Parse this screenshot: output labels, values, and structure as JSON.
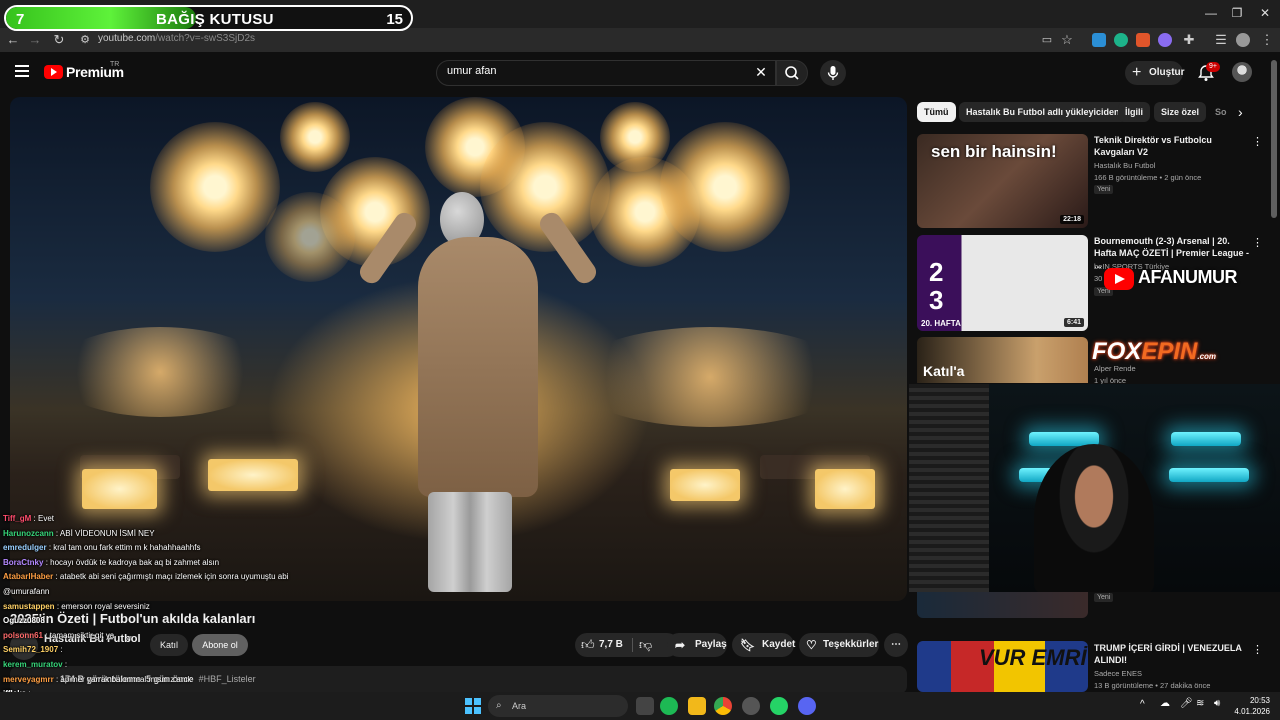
{
  "donation": {
    "count": "7",
    "title": "BAĞIŞ KUTUSU",
    "goal": "15",
    "progress": 0.47
  },
  "browser": {
    "url_host": "youtube.com",
    "url_path": "/watch?v=-swS3SjD2s"
  },
  "header": {
    "brand": "Premium",
    "region": "TR",
    "search_value": "umur afan",
    "create_label": "Oluştur",
    "notification_count": "9+"
  },
  "video": {
    "title": "2025'in Özeti | Futbol'un akılda kalanları",
    "channel": "Hastalık Bu Futbol",
    "join_label": "Katıl",
    "subscribe_label": "Abone ol",
    "likes": "7,7 B",
    "share_label": "Paylaş",
    "save_label": "Kaydet",
    "thanks_label": "Teşekkürler",
    "views": "174 B görüntüleme",
    "posted": "5 gün önce",
    "hashtag": "#HBF_Listeler"
  },
  "chips": [
    "Tümü",
    "Hastalık Bu Futbol adlı yükleyiciden",
    "İlgili",
    "Size özel",
    "So"
  ],
  "recommendations": [
    {
      "title": "Teknik Direktör vs Futbolcu Kavgaları V2",
      "channel": "Hastalık Bu Futbol",
      "views": "166 B görüntüleme",
      "age": "2 gün önce",
      "badge": "Yeni",
      "duration": "22:18",
      "thumb_text": "sen bir hainsin!"
    },
    {
      "title": "Bournemouth (2-3) Arsenal | 20. Hafta MAÇ ÖZETİ | Premier League - ...",
      "channel": "beIN SPORTS Türkiye",
      "views": "30",
      "age": "",
      "badge": "Yeni",
      "duration": "6:41",
      "score_home": "2",
      "score_away": "3",
      "week": "20. HAFTA"
    },
    {
      "title": "",
      "channel": "Alper Rende",
      "views": "",
      "age": "1 yıl önce",
      "badge": "",
      "duration": "",
      "thumb_text": "Katıl'a"
    },
    {
      "title": "",
      "channel": "",
      "views": "",
      "age": "",
      "badge": "Yeni",
      "duration": ""
    },
    {
      "title": "TRUMP İÇERİ GİRDİ | VENEZUELA ALINDI!",
      "channel": "Sadece ENES",
      "views": "13 B görüntüleme",
      "age": "27 dakika önce",
      "badge": "",
      "duration": "",
      "thumb_text": "VUR EMRİ"
    }
  ],
  "overlay_logos": {
    "afan": "AFANUMUR",
    "fox_a": "FOX",
    "fox_b": "EPIN",
    "fox_com": ".com"
  },
  "chat": [
    {
      "user": "Tiff_gM",
      "color": "#ff4d6d",
      "text": ": Evet"
    },
    {
      "user": "Harunozcann",
      "color": "#37d67a",
      "text": ": ABİ VİDEONUN İSMİ NEY"
    },
    {
      "user": "emredulger",
      "color": "#9ad0ff",
      "text": ": kral tam onu fark ettim m k hahahhaahhfs"
    },
    {
      "user": "BoraCtnky",
      "color": "#b388ff",
      "text": ": hocayı övdük te kadroya bak aq bi zahmet alsın"
    },
    {
      "user": "AtabarlHaber",
      "color": "#ff9f43",
      "text": ": atabetk abi seni çağırmıştı maçı izlemek için sonra uyumuştu abi"
    },
    {
      "user": "",
      "color": "#ffffff",
      "text": "@umurafann"
    },
    {
      "user": "samustappen",
      "color": "#ffd166",
      "text": ": emerson royal seversiniz"
    },
    {
      "user": "Oguzz0808",
      "color": "#ffffff",
      "text": ""
    },
    {
      "user": "polsonn61",
      "color": "#ff6b6b",
      "text": ": tamam siktir git ya"
    },
    {
      "user": "Semih72_1907",
      "color": "#ffd166",
      "text": ":"
    },
    {
      "user": "kerem_muratov",
      "color": "#37d67a",
      "text": ":"
    },
    {
      "user": "merveyagmrr",
      "color": "#ff9f43",
      "text": ": apimer yarrak balon mal mısınız amk"
    },
    {
      "user": "iffleks",
      "color": "#ffffff",
      "text": ":"
    }
  ],
  "taskbar": {
    "search_placeholder": "Ara",
    "time": "20:53",
    "date": "4.01.2026"
  },
  "colors": {
    "accent": "#ff0000",
    "donation_green": "#4fe02e",
    "webcam_neon": "#3fd6f0"
  }
}
